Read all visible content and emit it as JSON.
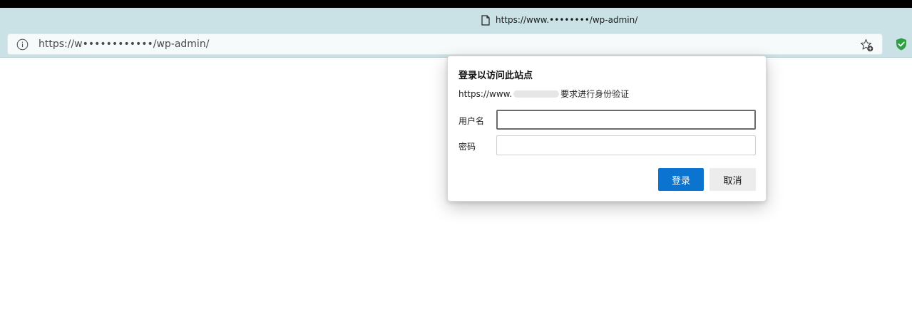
{
  "browser": {
    "tab": {
      "title": "https://www.••••••••/wp-admin/"
    },
    "address": {
      "url": "https://w••••••••••••/wp-admin/"
    },
    "icons": [
      "document-icon",
      "info-icon",
      "add-favorite-icon",
      "shield-icon"
    ],
    "colors": {
      "chrome": "#cae2e5",
      "shield": "#2ea043"
    }
  },
  "dialog": {
    "title": "登录以访问此站点",
    "subtitle_prefix": "https://www.",
    "subtitle_suffix": "要求进行身份验证",
    "username_label": "用户名",
    "password_label": "密码",
    "username_value": "",
    "password_value": "",
    "login_button": "登录",
    "cancel_button": "取消",
    "accent": "#0a74d0"
  }
}
